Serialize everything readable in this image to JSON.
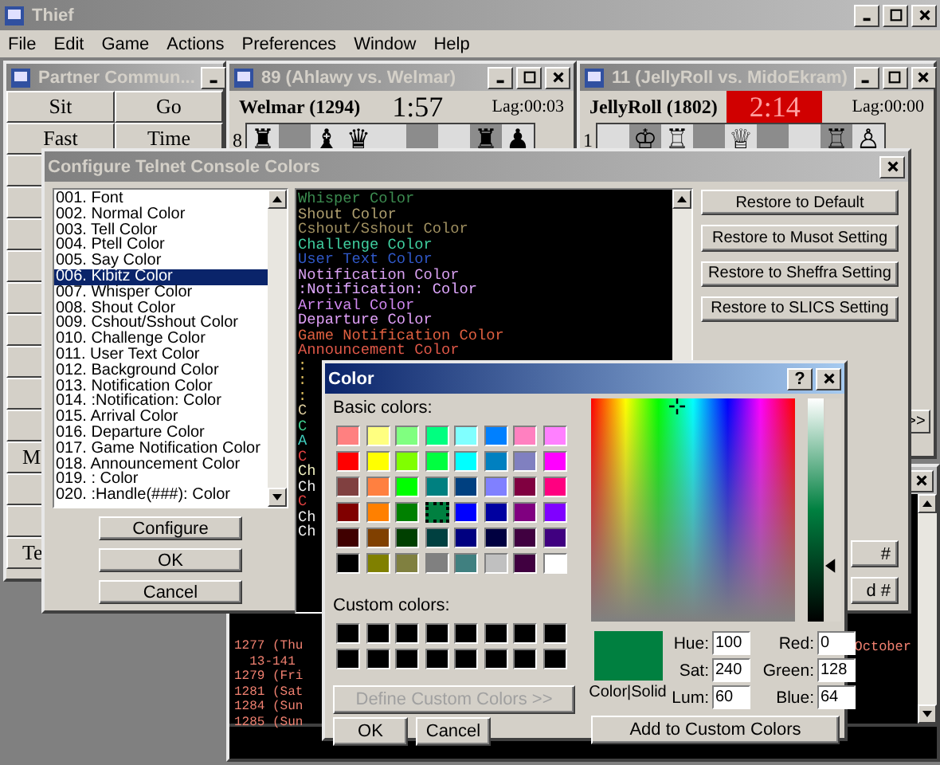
{
  "app": {
    "title": "Thief",
    "active": false,
    "menu": [
      "File",
      "Edit",
      "Game",
      "Actions",
      "Preferences",
      "Window",
      "Help"
    ]
  },
  "partner": {
    "title": "Partner Commun...",
    "active": false,
    "rows": [
      {
        "left": "Sit",
        "right": "Go",
        "kind": "full"
      },
      {
        "left": "Fast",
        "right": "Time",
        "kind": "full"
      },
      {},
      {},
      {},
      {},
      {},
      {},
      {},
      {},
      {},
      {
        "left": "M",
        "kind": "partial"
      },
      {},
      {},
      {
        "left": "Te",
        "kind": "partial"
      }
    ]
  },
  "games": [
    {
      "title": "89 (Ahlawy vs. Welmar)",
      "active": false,
      "player": "Welmar (1294)",
      "clock": "1:57",
      "running": false,
      "lag": "Lag:00:03",
      "rank": "8",
      "squares": [
        {
          "piece": "♜",
          "dark": false
        },
        {
          "dark": true
        },
        {
          "piece": "♝",
          "dark": false
        },
        {
          "piece": "♛",
          "dark": false
        },
        {
          "dark": false
        },
        {
          "dark": true
        },
        {
          "dark": false
        },
        {
          "piece": "♜",
          "dark": true
        },
        {
          "piece": "♟",
          "dark": false
        }
      ]
    },
    {
      "title": "11 (JellyRoll vs. MidoEkram)",
      "active": false,
      "player": "JellyRoll (1802)",
      "clock": "2:14",
      "running": true,
      "lag": "Lag:00:00",
      "rank": "1",
      "more": ">>",
      "squares": [
        {
          "dark": false
        },
        {
          "piece": "♔",
          "dark": true
        },
        {
          "piece": "♖",
          "dark": false
        },
        {
          "dark": true
        },
        {
          "piece": "♕",
          "dark": false
        },
        {
          "dark": true
        },
        {
          "dark": false
        },
        {
          "piece": "♖",
          "dark": true
        },
        {
          "piece": "♙",
          "dark": false
        }
      ]
    }
  ],
  "console": {
    "active": false,
    "lines": [
      {
        "text": "1277 (Thu",
        "tail": "October"
      },
      {
        "text": "  13-141"
      },
      {
        "text": "1279 (Fri"
      },
      {
        "text": "1281 (Sat"
      },
      {
        "text": "1284 (Sun"
      },
      {
        "text": "1285 (Sun"
      }
    ]
  },
  "configure": {
    "title": "Configure Telnet Console Colors",
    "active": false,
    "items": [
      {
        "label": "001. Font",
        "selected": false
      },
      {
        "label": "002. Normal Color",
        "selected": false
      },
      {
        "label": "003. Tell Color",
        "selected": false
      },
      {
        "label": "004. Ptell Color",
        "selected": false
      },
      {
        "label": "005. Say Color",
        "selected": false
      },
      {
        "label": "006. Kibitz Color",
        "selected": true
      },
      {
        "label": "007. Whisper Color",
        "selected": false
      },
      {
        "label": "008. Shout Color",
        "selected": false
      },
      {
        "label": "009. Cshout/Sshout Color",
        "selected": false
      },
      {
        "label": "010. Challenge Color",
        "selected": false
      },
      {
        "label": "011. User Text Color",
        "selected": false
      },
      {
        "label": "012. Background Color",
        "selected": false
      },
      {
        "label": "013. Notification Color",
        "selected": false
      },
      {
        "label": "014. :Notification: Color",
        "selected": false
      },
      {
        "label": "015. Arrival Color",
        "selected": false
      },
      {
        "label": "016. Departure Color",
        "selected": false
      },
      {
        "label": "017. Game Notification Color",
        "selected": false
      },
      {
        "label": "018. Announcement Color",
        "selected": false
      },
      {
        "label": "019. : Color",
        "selected": false
      },
      {
        "label": "020. :Handle(###): Color",
        "selected": false
      }
    ],
    "buttons": [
      "Configure",
      "OK",
      "Cancel"
    ],
    "preview": [
      {
        "text": "Whisper Color",
        "color": "#3c8c50"
      },
      {
        "text": "Shout Color",
        "color": "#b0a070"
      },
      {
        "text": "Cshout/Sshout Color",
        "color": "#a09060"
      },
      {
        "text": "Challenge Color",
        "color": "#40d0a0"
      },
      {
        "text": "User Text Color",
        "color": "#3058c8"
      },
      {
        "text": "Notification Color",
        "color": "#d8a0f0"
      },
      {
        "text": ":Notification: Color",
        "color": "#e0a8ff"
      },
      {
        "text": "Arrival Color",
        "color": "#d088f0"
      },
      {
        "text": "Departure Color",
        "color": "#e0a0f8"
      },
      {
        "text": "Game Notification Color",
        "color": "#e06040"
      },
      {
        "text": "Announcement Color",
        "color": "#e05848"
      },
      {
        "text": ":",
        "color": "#e0c060"
      },
      {
        "text": ":",
        "color": "#e0c060"
      },
      {
        "text": ":",
        "color": "#e0c060"
      },
      {
        "text": "C",
        "color": "#e0d0a0"
      },
      {
        "text": "C",
        "color": "#40d090"
      },
      {
        "text": "A",
        "color": "#40d0c0"
      },
      {
        "text": "C",
        "color": "#e04040"
      },
      {
        "text": "Ch",
        "color": "#f0f0c0"
      },
      {
        "text": "Ch",
        "color": "#f0f0f0"
      },
      {
        "text": "C",
        "color": "#e04040"
      },
      {
        "text": "Ch",
        "color": "#f0f0f0"
      },
      {
        "text": "Ch",
        "color": "#f0f0f0"
      }
    ],
    "restore_buttons": [
      "Restore to Default",
      "Restore to Musot Setting",
      "Restore to Sheffra Setting",
      "Restore to SLICS Setting"
    ],
    "handle_buttons": [
      "#",
      "d #"
    ]
  },
  "color_dialog": {
    "title": "Color",
    "active": true,
    "help": "?",
    "basic_label": "Basic colors:",
    "basic_colors": [
      {
        "color": "#ff8080",
        "selected": false
      },
      {
        "color": "#ffff80",
        "selected": false
      },
      {
        "color": "#80ff80",
        "selected": false
      },
      {
        "color": "#00ff80",
        "selected": false
      },
      {
        "color": "#80ffff",
        "selected": false
      },
      {
        "color": "#0080ff",
        "selected": false
      },
      {
        "color": "#ff80c0",
        "selected": false
      },
      {
        "color": "#ff80ff",
        "selected": false
      },
      {
        "color": "#ff0000",
        "selected": false
      },
      {
        "color": "#ffff00",
        "selected": false
      },
      {
        "color": "#80ff00",
        "selected": false
      },
      {
        "color": "#00ff40",
        "selected": false
      },
      {
        "color": "#00ffff",
        "selected": false
      },
      {
        "color": "#0080c0",
        "selected": false
      },
      {
        "color": "#8080c0",
        "selected": false
      },
      {
        "color": "#ff00ff",
        "selected": false
      },
      {
        "color": "#804040",
        "selected": false
      },
      {
        "color": "#ff8040",
        "selected": false
      },
      {
        "color": "#00ff00",
        "selected": false
      },
      {
        "color": "#008080",
        "selected": false
      },
      {
        "color": "#004080",
        "selected": false
      },
      {
        "color": "#8080ff",
        "selected": false
      },
      {
        "color": "#800040",
        "selected": false
      },
      {
        "color": "#ff0080",
        "selected": false
      },
      {
        "color": "#800000",
        "selected": false
      },
      {
        "color": "#ff8000",
        "selected": false
      },
      {
        "color": "#008000",
        "selected": false
      },
      {
        "color": "#008040",
        "selected": true
      },
      {
        "color": "#0000ff",
        "selected": false
      },
      {
        "color": "#0000a0",
        "selected": false
      },
      {
        "color": "#800080",
        "selected": false
      },
      {
        "color": "#8000ff",
        "selected": false
      },
      {
        "color": "#400000",
        "selected": false
      },
      {
        "color": "#804000",
        "selected": false
      },
      {
        "color": "#004000",
        "selected": false
      },
      {
        "color": "#004040",
        "selected": false
      },
      {
        "color": "#000080",
        "selected": false
      },
      {
        "color": "#000040",
        "selected": false
      },
      {
        "color": "#400040",
        "selected": false
      },
      {
        "color": "#400080",
        "selected": false
      },
      {
        "color": "#000000",
        "selected": false
      },
      {
        "color": "#808000",
        "selected": false
      },
      {
        "color": "#808040",
        "selected": false
      },
      {
        "color": "#808080",
        "selected": false
      },
      {
        "color": "#408080",
        "selected": false
      },
      {
        "color": "#c0c0c0",
        "selected": false
      },
      {
        "color": "#400040",
        "selected": false
      },
      {
        "color": "#ffffff",
        "selected": false
      }
    ],
    "custom_label": "Custom colors:",
    "define_button": {
      "label": "Define Custom Colors >>",
      "disabled": true
    },
    "buttons": [
      "OK",
      "Cancel"
    ],
    "lum_slider": {
      "level": 0.25
    },
    "preview_label": "Color|Solid",
    "hsl_fields": [
      {
        "label": "Hue:",
        "value": "100"
      },
      {
        "label": "Sat:",
        "value": "240"
      },
      {
        "label": "Lum:",
        "value": "60"
      }
    ],
    "rgb_fields": [
      {
        "label": "Red:",
        "value": "0"
      },
      {
        "label": "Green:",
        "value": "128"
      },
      {
        "label": "Blue:",
        "value": "64"
      }
    ],
    "add_button": "Add to Custom Colors"
  }
}
